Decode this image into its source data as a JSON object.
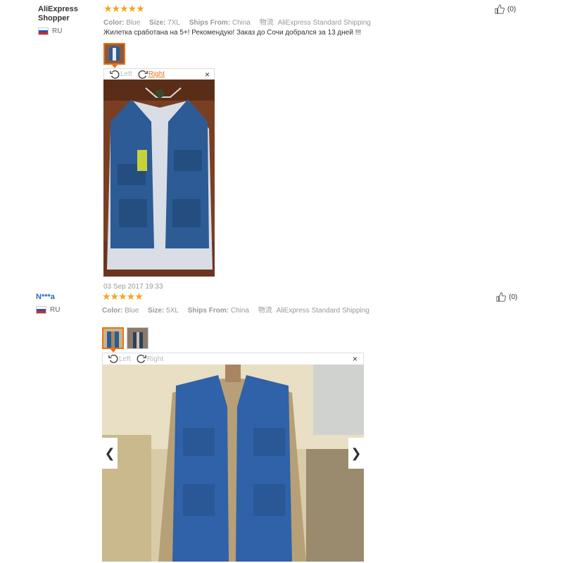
{
  "reviews": [
    {
      "user": "AliExpress Shopper",
      "country": "RU",
      "stars": "★★★★★",
      "color_label": "Color:",
      "color": "Blue",
      "size_label": "Size:",
      "size": "7XL",
      "ships_label": "Ships From:",
      "ships": "China",
      "logistics_icon": "物流",
      "shipping": "AliExpress Standard Shipping",
      "text": "Жилетка сработана на 5+! Рекомендую! Заказ до Сочи добрался за 13 дней !!!",
      "helpful": "(0)",
      "rotate_left": "Left",
      "rotate_right": "Right",
      "close": "×",
      "date": "03 Sep 2017 19:33"
    },
    {
      "user": "N***a",
      "country": "RU",
      "stars": "★★★★★",
      "color_label": "Color:",
      "color": "Blue",
      "size_label": "Size:",
      "size": "5XL",
      "ships_label": "Ships From:",
      "ships": "China",
      "logistics_icon": "物流",
      "shipping": "AliExpress Standard Shipping",
      "helpful": "(0)",
      "rotate_left": "Left",
      "rotate_right": "Right",
      "close": "×",
      "prev": "❮",
      "next": "❯"
    }
  ],
  "colors": {
    "accent": "#e8731a",
    "star": "#f5a623",
    "link": "#2a6db5",
    "denim": "#2d5b95"
  },
  "icons": [
    "flag-ru-icon",
    "thumbs-up-icon",
    "rotate-left-icon",
    "rotate-right-icon",
    "close-icon",
    "chevron-left-icon",
    "chevron-right-icon"
  ]
}
